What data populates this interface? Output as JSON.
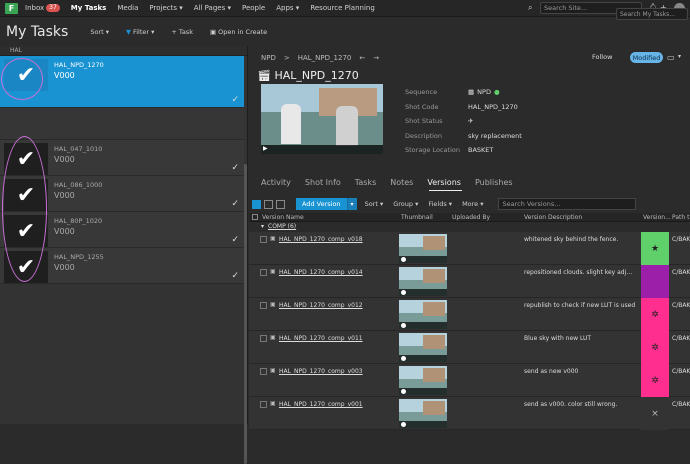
{
  "topnav": {
    "logo": "F",
    "inbox_label": "Inbox",
    "inbox_count": "37",
    "items": [
      "My Tasks",
      "Media",
      "Projects ▾",
      "All Pages ▾",
      "People",
      "Apps ▾",
      "Resource Planning"
    ],
    "search_placeholder": "Search Site..."
  },
  "subbar": {
    "title": "My Tasks",
    "sort": "Sort ▾",
    "filter": "Filter ▾",
    "task": "+ Task",
    "open_in_create": "Open in Create",
    "search_placeholder": "Search My Tasks..."
  },
  "task_list": {
    "group": "HAL",
    "tasks": [
      {
        "name": "HAL_NPD_1270",
        "version": "V000"
      },
      {
        "name": "HAL_047_1010",
        "version": "V000"
      },
      {
        "name": "HAL_086_1000",
        "version": "V000"
      },
      {
        "name": "HAL_80P_1020",
        "version": "V000"
      },
      {
        "name": "HAL_NPD_1255",
        "version": "V000"
      }
    ]
  },
  "detail": {
    "breadcrumb": [
      "NPD",
      ">",
      "HAL_NPD_1270"
    ],
    "follow": "Follow",
    "modified": "Modified",
    "title": "HAL_NPD_1270",
    "fields": [
      {
        "label": "Sequence",
        "value": "NPD"
      },
      {
        "label": "Shot Code",
        "value": "HAL_NPD_1270"
      },
      {
        "label": "Shot Status",
        "value": ""
      },
      {
        "label": "Description",
        "value": "sky replacement"
      },
      {
        "label": "Storage Location",
        "value": "BASKET"
      }
    ],
    "tabs": [
      "Activity",
      "Shot Info",
      "Tasks",
      "Notes",
      "Versions",
      "Publishes"
    ],
    "active_tab": "Versions"
  },
  "versions_toolbar": {
    "add_version": "Add Version",
    "sort": "Sort ▾",
    "group": "Group ▾",
    "fields": "Fields ▾",
    "more": "More ▾",
    "search_placeholder": "Search Versions..."
  },
  "versions_grid": {
    "columns": [
      "Version Name",
      "Thumbnail",
      "Uploaded By",
      "Version Description",
      "Version...",
      "Path t"
    ],
    "group_label": "COMP (6)",
    "rows": [
      {
        "name": "HAL_NPD_1270_comp_v018",
        "description": "whitened sky behind the fence.",
        "status_color": "#5fd06a",
        "status_icon": "★",
        "path": "C/BAK"
      },
      {
        "name": "HAL_NPD_1270_comp_v014",
        "description": "repositioned clouds. slight key adjustm...",
        "status_color": "#9b1fa8",
        "status_icon": "",
        "path": "C/BAK"
      },
      {
        "name": "HAL_NPD_1270_comp_v012",
        "description": "republish to check if new LUT is used",
        "status_color": "#ff2e8f",
        "status_icon": "✲",
        "path": "C/BAK"
      },
      {
        "name": "HAL_NPD_1270_comp_v011",
        "description": "Blue sky with new LUT",
        "status_color": "#ff2e8f",
        "status_icon": "✲",
        "path": "C/BAK"
      },
      {
        "name": "HAL_NPD_1270_comp_v003",
        "description": "send as new v000",
        "status_color": "#ff2e8f",
        "status_icon": "✲",
        "path": "C/BAK"
      },
      {
        "name": "HAL_NPD_1270_comp_v001",
        "description": "send as v000. color still wrong.",
        "status_color": "#333333",
        "status_icon": "×",
        "path": "C/BAK"
      }
    ]
  },
  "colors": {
    "accent": "#1a93d3",
    "annotation": "#c86fd6"
  }
}
